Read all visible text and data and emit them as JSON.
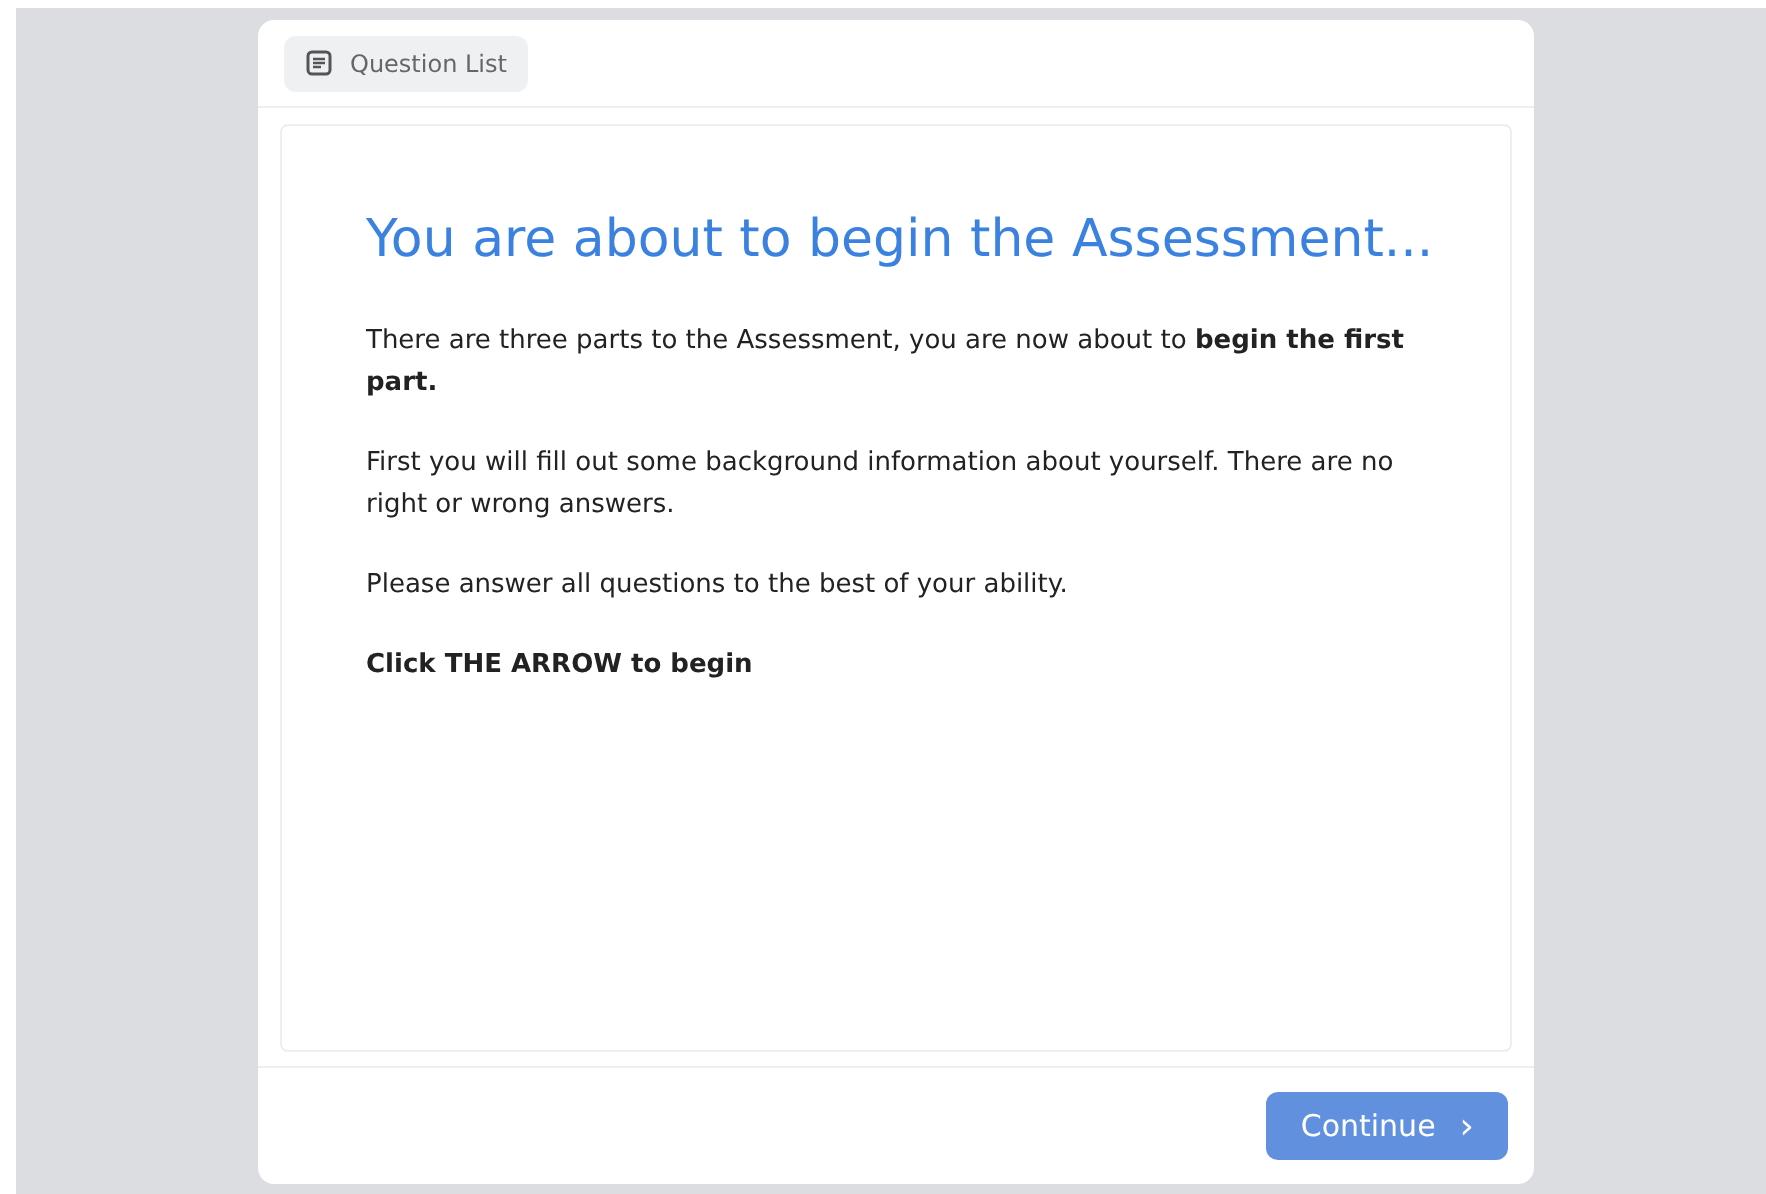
{
  "header": {
    "question_list_button": "Question List"
  },
  "content": {
    "title": "You are about to begin the Assessment...",
    "paragraphs": [
      {
        "kind": "normal",
        "text": "There are three parts to the Assessment, you are now about to **begin the first part.**"
      },
      {
        "kind": "normal",
        "text": "First you will fill out some background information about yourself. There are no right or wrong answers."
      },
      {
        "kind": "normal",
        "text": "Please answer all questions to the best of your ability."
      },
      {
        "kind": "strong",
        "text": "Click THE ARROW to begin"
      }
    ]
  },
  "footer": {
    "continue_button": {
      "label": "Continue",
      "icon": "›"
    }
  }
}
